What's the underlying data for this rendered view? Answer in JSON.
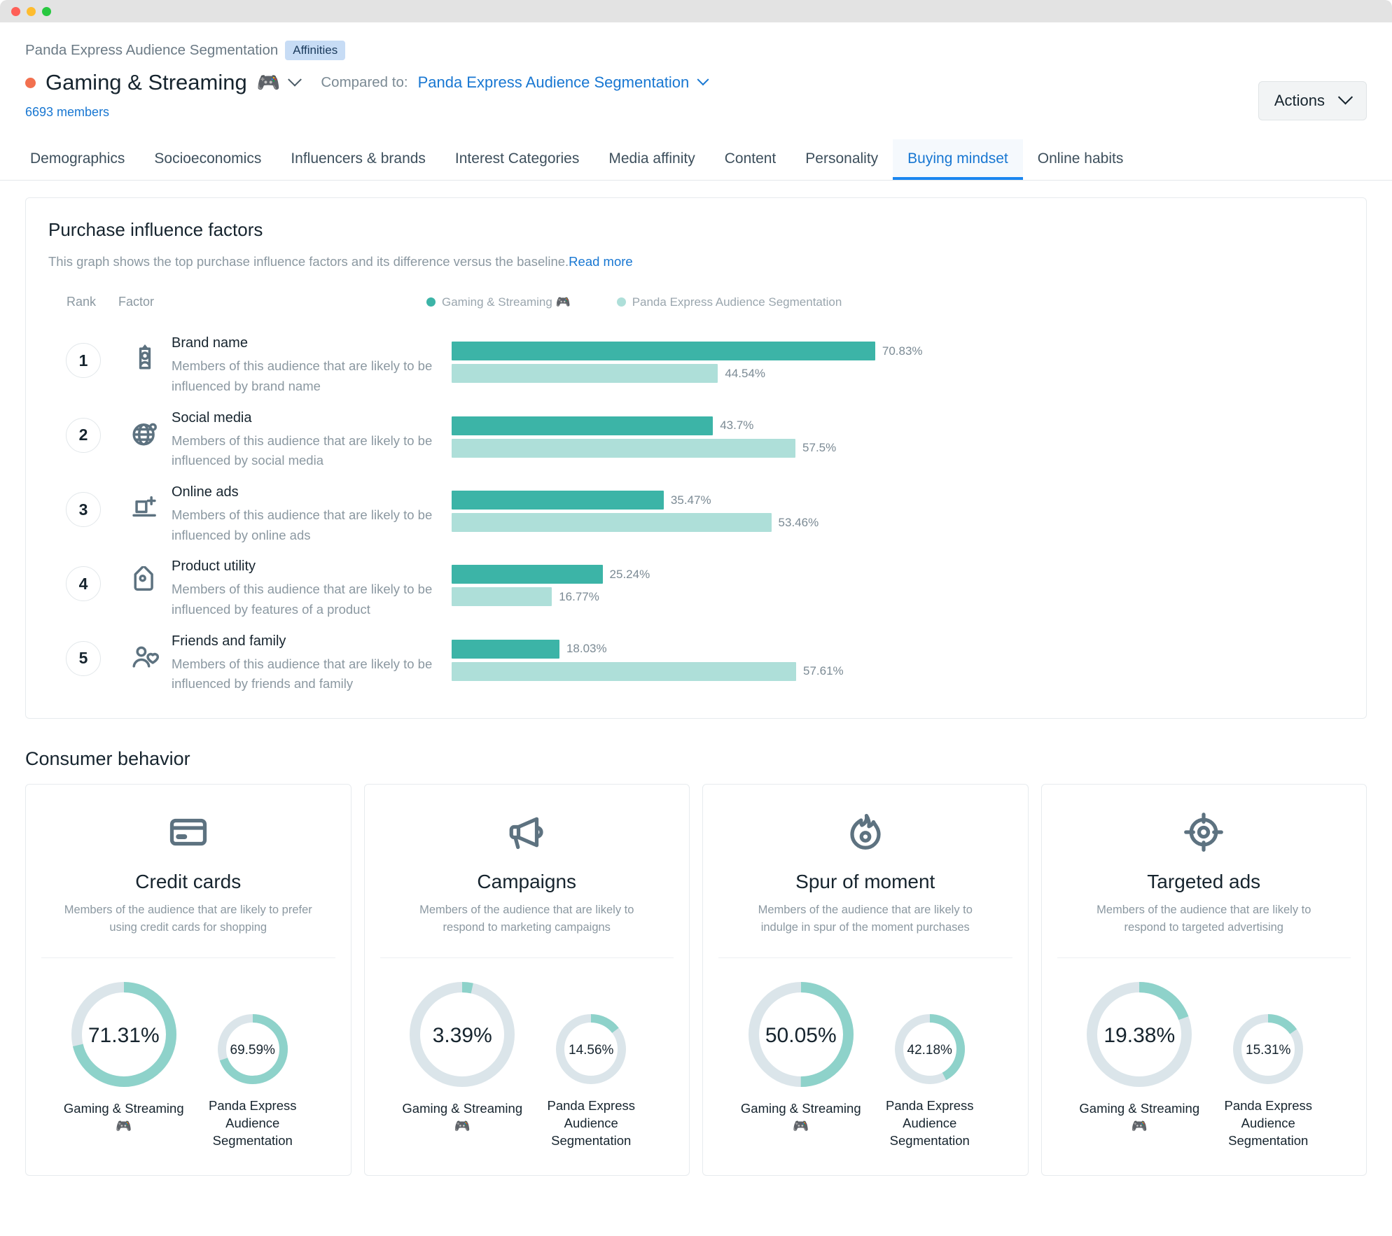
{
  "window": {
    "traffic_lights": [
      "close",
      "minimize",
      "maximize"
    ]
  },
  "header": {
    "breadcrumb": "Panda Express Audience Segmentation",
    "badge": "Affinities",
    "audience_name": "Gaming & Streaming",
    "audience_emoji": "🎮",
    "audience_dot_color": "#f2704f",
    "compared_label": "Compared to:",
    "compared_value": "Panda Express Audience Segmentation",
    "members": "6693 members",
    "actions_label": "Actions"
  },
  "tabs": [
    {
      "label": "Demographics",
      "active": false
    },
    {
      "label": "Socioeconomics",
      "active": false
    },
    {
      "label": "Influencers & brands",
      "active": false
    },
    {
      "label": "Interest Categories",
      "active": false
    },
    {
      "label": "Media affinity",
      "active": false
    },
    {
      "label": "Content",
      "active": false
    },
    {
      "label": "Personality",
      "active": false
    },
    {
      "label": "Buying mindset",
      "active": true
    },
    {
      "label": "Online habits",
      "active": false
    }
  ],
  "purchase_panel": {
    "title": "Purchase influence factors",
    "subtitle": "This graph shows the top purchase influence factors and its difference versus the baseline.",
    "read_more": "Read more",
    "col_rank": "Rank",
    "col_factor": "Factor",
    "legend": [
      {
        "label": "Gaming & Streaming 🎮",
        "color": "#3cb4a7"
      },
      {
        "label": "Panda Express Audience Segmentation",
        "color": "#aedfd9"
      }
    ]
  },
  "chart_data": {
    "type": "bar",
    "title": "Purchase influence factors",
    "orientation": "horizontal",
    "xlabel": "",
    "ylabel": "",
    "xlim": [
      0,
      100
    ],
    "unit": "%",
    "grid": false,
    "legend_position": "top-right",
    "categories": [
      "Brand name",
      "Social media",
      "Online ads",
      "Product utility",
      "Friends and family"
    ],
    "series": [
      {
        "name": "Gaming & Streaming 🎮",
        "color": "#3cb4a7",
        "values": [
          70.83,
          43.7,
          35.47,
          25.24,
          18.03
        ]
      },
      {
        "name": "Panda Express Audience Segmentation",
        "color": "#aedfd9",
        "values": [
          44.54,
          57.5,
          53.46,
          16.77,
          57.61
        ]
      }
    ],
    "value_labels": [
      [
        "70.83%",
        "44.54%"
      ],
      [
        "43.7%",
        "57.5%"
      ],
      [
        "35.47%",
        "53.46%"
      ],
      [
        "25.24%",
        "16.77%"
      ],
      [
        "18.03%",
        "57.61%"
      ]
    ]
  },
  "factors": [
    {
      "rank": "1",
      "icon": "id-badge-icon",
      "title": "Brand name",
      "desc": "Members of this audience that are likely to be influenced by brand name",
      "primary": 70.83,
      "primary_label": "70.83%",
      "secondary": 44.54,
      "secondary_label": "44.54%"
    },
    {
      "rank": "2",
      "icon": "globe-icon",
      "title": "Social media",
      "desc": "Members of this audience that are likely to be influenced by social media",
      "primary": 43.7,
      "primary_label": "43.7%",
      "secondary": 57.5,
      "secondary_label": "57.5%"
    },
    {
      "rank": "3",
      "icon": "laptop-plus-icon",
      "title": "Online ads",
      "desc": "Members of this audience that are likely to be influenced by online ads",
      "primary": 35.47,
      "primary_label": "35.47%",
      "secondary": 53.46,
      "secondary_label": "53.46%"
    },
    {
      "rank": "4",
      "icon": "price-tag-icon",
      "title": "Product utility",
      "desc": "Members of this audience that are likely to be influenced by features of a product",
      "primary": 25.24,
      "primary_label": "25.24%",
      "secondary": 16.77,
      "secondary_label": "16.77%"
    },
    {
      "rank": "5",
      "icon": "person-heart-icon",
      "title": "Friends and family",
      "desc": "Members of this audience that are likely to be influenced by friends and family",
      "primary": 18.03,
      "primary_label": "18.03%",
      "secondary": 57.61,
      "secondary_label": "57.61%"
    }
  ],
  "consumer_behavior": {
    "title": "Consumer behavior",
    "donut_colors": {
      "filled": "#8ed2ca",
      "track": "#dbe5ea"
    },
    "cards": [
      {
        "icon": "credit-card-icon",
        "name": "Credit cards",
        "desc": "Members of the audience that are likely to prefer using credit cards for shopping",
        "primary_value": 71.31,
        "primary_label": "71.31%",
        "primary_caption": "Gaming & Streaming 🎮",
        "secondary_value": 69.59,
        "secondary_label": "69.59%",
        "secondary_caption": "Panda Express Audience Segmentation"
      },
      {
        "icon": "megaphone-icon",
        "name": "Campaigns",
        "desc": "Members of the audience that are likely to respond to marketing campaigns",
        "primary_value": 3.39,
        "primary_label": "3.39%",
        "primary_caption": "Gaming & Streaming 🎮",
        "secondary_value": 14.56,
        "secondary_label": "14.56%",
        "secondary_caption": "Panda Express Audience Segmentation"
      },
      {
        "icon": "flame-icon",
        "name": "Spur of moment",
        "desc": "Members of the audience that are likely to indulge in spur of the moment purchases",
        "primary_value": 50.05,
        "primary_label": "50.05%",
        "primary_caption": "Gaming & Streaming 🎮",
        "secondary_value": 42.18,
        "secondary_label": "42.18%",
        "secondary_caption": "Panda Express Audience Segmentation"
      },
      {
        "icon": "target-icon",
        "name": "Targeted ads",
        "desc": "Members of the audience that are likely to respond to targeted advertising",
        "primary_value": 19.38,
        "primary_label": "19.38%",
        "primary_caption": "Gaming & Streaming 🎮",
        "secondary_value": 15.31,
        "secondary_label": "15.31%",
        "secondary_caption": "Panda Express Audience Segmentation"
      }
    ]
  }
}
